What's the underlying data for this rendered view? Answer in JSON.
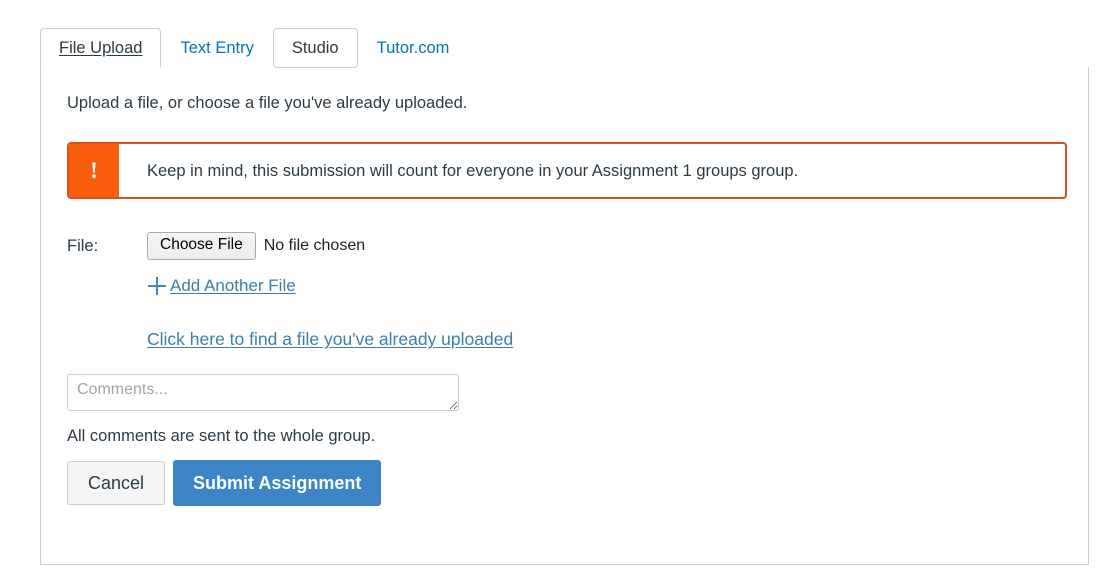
{
  "colors": {
    "link_blue": "#0374B5",
    "text_dark": "#2d3b45",
    "alert_orange": "#f95e0f",
    "alert_border": "#d9501e",
    "submit_blue": "#3d84c6",
    "border_gray": "#c7cdd1"
  },
  "tabs": [
    {
      "label": "File Upload",
      "state": "active"
    },
    {
      "label": "Text Entry",
      "state": "default"
    },
    {
      "label": "Studio",
      "state": "hover"
    },
    {
      "label": "Tutor.com",
      "state": "default"
    }
  ],
  "main": {
    "intro": "Upload a file, or choose a file you've already uploaded.",
    "alert": {
      "icon": "exclamation-icon",
      "icon_glyph": "!",
      "message": "Keep in mind, this submission will count for everyone in your Assignment 1 groups group."
    },
    "file_field": {
      "label": "File:",
      "button_label": "Choose File",
      "status": "No file chosen"
    },
    "add_another_file": {
      "icon": "plus-icon",
      "label": " Add Another File"
    },
    "find_uploaded": "Click here to find a file you've already uploaded",
    "comments": {
      "value": "",
      "placeholder": "Comments..."
    },
    "group_note": "All comments are sent to the whole group."
  },
  "footer": {
    "cancel_label": "Cancel",
    "submit_label": "Submit Assignment"
  }
}
